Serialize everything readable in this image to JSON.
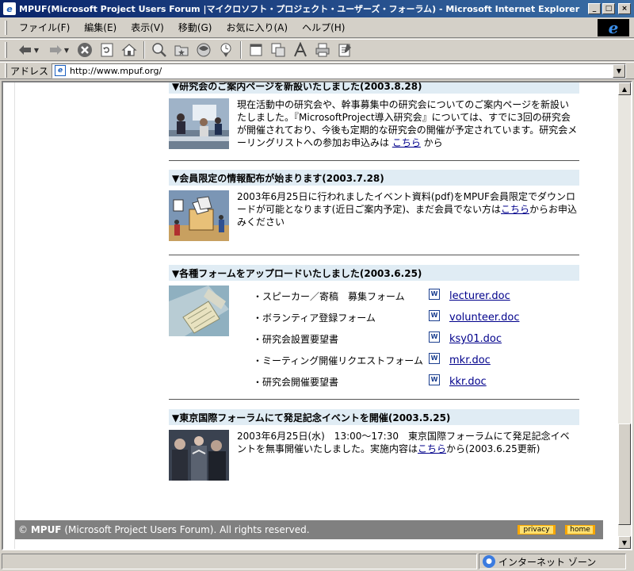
{
  "window": {
    "title": "MPUF(Microsoft Project Users Forum |マイクロソフト・プロジェクト・ユーザーズ・フォーラム) - Microsoft Internet Explorer",
    "min_label": "_",
    "max_label": "□",
    "close_label": "×"
  },
  "menu": [
    "ファイル(F)",
    "編集(E)",
    "表示(V)",
    "移動(G)",
    "お気に入り(A)",
    "ヘルプ(H)"
  ],
  "address": {
    "label": "アドレス",
    "url": "http://www.mpuf.org/"
  },
  "sections": [
    {
      "title": "▼研究会のご案内ページを新設いたしました(2003.8.28)",
      "text": "現在活動中の研究会や、幹事募集中の研究会についてのご案内ページを新設いたしました。『MicrosoftProject導入研究会』については、すでに3回の研究会が開催されており、今後も定期的な研究会の開催が予定されています。研究会メーリングリストへの参加お申込みは ",
      "link": "こちら",
      "after": " から"
    },
    {
      "title": "▼会員限定の情報配布が始まります(2003.7.28)",
      "text": "2003年6月25日に行われましたイベント資料(pdf)をMPUF会員限定でダウンロードが可能となります(近日ご案内予定)、まだ会員でない方は",
      "link": "こちら",
      "after": "からお申込みください"
    },
    {
      "title": "▼各種フォームをアップロードいたしました(2003.6.25)",
      "forms": [
        {
          "label": "・スピーカー／寄稿　募集フォーム",
          "file": "lecturer.doc"
        },
        {
          "label": "・ボランティア登録フォーム",
          "file": "volunteer.doc"
        },
        {
          "label": "・研究会設置要望書",
          "file": "ksy01.doc"
        },
        {
          "label": "・ミーティング開催リクエストフォーム",
          "file": "mkr.doc"
        },
        {
          "label": "・研究会開催要望書",
          "file": "kkr.doc"
        }
      ]
    },
    {
      "title": "▼東京国際フォーラムにて発足記念イベントを開催(2003.5.25)",
      "text": "2003年6月25日(水)　13:00～17:30　東京国際フォーラムにて発足記念イベントを無事開催いたしました。実施内容は",
      "link": "こちら",
      "after": "から(2003.6.25更新)"
    }
  ],
  "footer": {
    "copyright": "©",
    "brand": "MPUF",
    "text": "(Microsoft Project Users Forum). All rights reserved.",
    "privacy": "privacy",
    "home": "home"
  },
  "status": {
    "zone": "インターネット ゾーン"
  },
  "colors": {
    "section_header_bg": "#e0ecf4",
    "footer_bg": "#808080",
    "link": "#00008b",
    "footer_button": "#f7a600"
  }
}
